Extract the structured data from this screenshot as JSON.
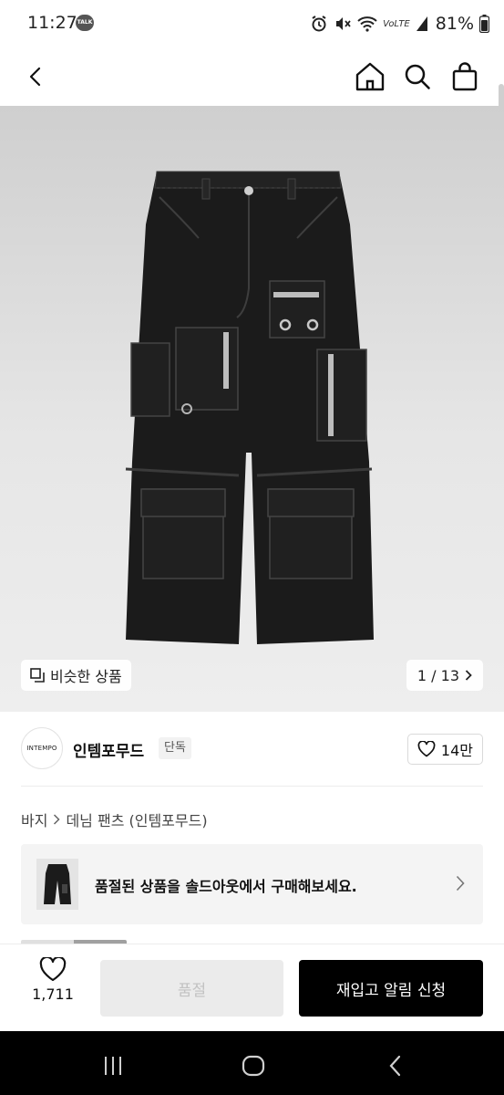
{
  "status_bar": {
    "time": "11:27",
    "talk_badge": "TALK",
    "carrier_label": "VoLTE",
    "battery_percent": "81%",
    "icons": [
      "kakaotalk-icon",
      "alarm-icon",
      "mute-icon",
      "wifi-icon",
      "signal-icon",
      "battery-icon"
    ]
  },
  "header": {
    "icons": [
      "back-arrow-icon",
      "home-icon",
      "search-icon",
      "shopping-bag-icon"
    ]
  },
  "product_image": {
    "alt": "black cargo denim pants",
    "similar_products_label": "비슷한 상품",
    "page_current": "1",
    "page_total": "13",
    "page_counter_text": "1 / 13"
  },
  "brand": {
    "logo_text": "INTEMPO",
    "name": "인템포무드",
    "badge": "단독",
    "like_count": "14만"
  },
  "breadcrumb": {
    "items": [
      "바지",
      "데님 팬츠 (인템포무드)"
    ]
  },
  "soldout_banner": {
    "text": "품절된 상품을 솔드아웃에서 구매해보세요."
  },
  "action_bar": {
    "wish_count": "1,711",
    "soldout_label": "품절",
    "restock_label": "재입고 알림 신청"
  },
  "colors": {
    "accent": "#000000",
    "disabled_bg": "#ebebeb",
    "disabled_text": "#c2c2c2",
    "image_bg": "#e6e6e6"
  }
}
